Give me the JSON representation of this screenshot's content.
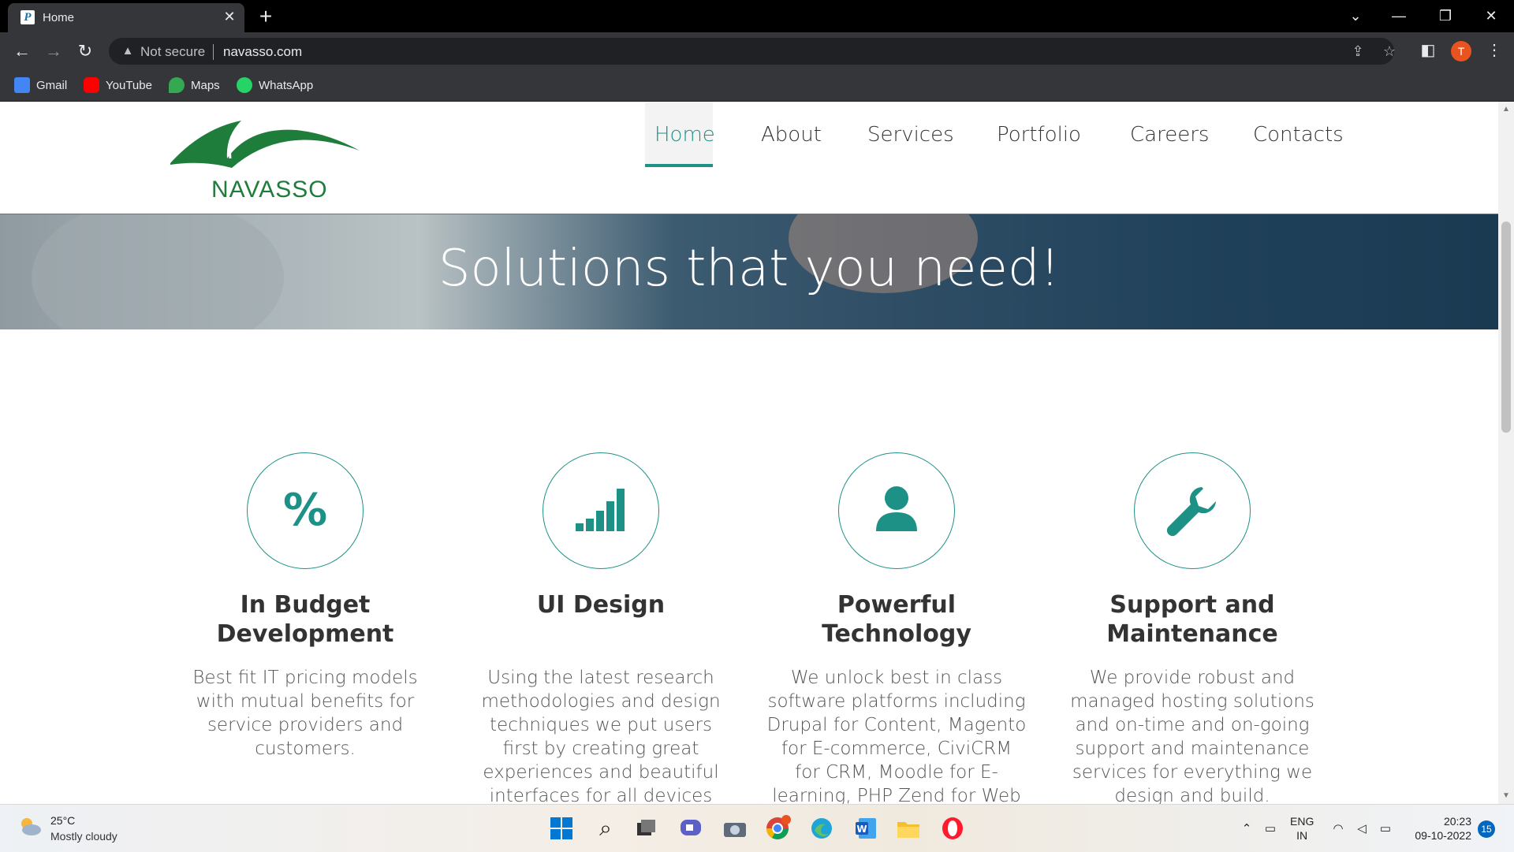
{
  "browser": {
    "tab_title": "Home",
    "tab_close": "✕",
    "new_tab": "+",
    "security": "Not secure",
    "url": "navasso.com",
    "profile_initial": "T",
    "bookmarks": [
      "Gmail",
      "YouTube",
      "Maps",
      "WhatsApp"
    ]
  },
  "site": {
    "logo_text": "NAVASSO",
    "nav": [
      "Home",
      "About",
      "Services",
      "Portfolio",
      "Careers",
      "Contacts"
    ],
    "active_nav": "Home",
    "hero_title": "Solutions that you need!",
    "accent_color": "#1e9187",
    "features": [
      {
        "icon": "percent-icon",
        "title": "In Budget Development",
        "desc": "Best fit IT pricing models with mutual benefits for service providers and customers."
      },
      {
        "icon": "signal-bars-icon",
        "title": "UI Design",
        "desc": "Using the latest research methodologies and design techniques we put users first by creating great experiences and beautiful interfaces for all devices"
      },
      {
        "icon": "user-icon",
        "title": "Powerful Technology",
        "desc": "We unlock best in class software platforms including Drupal for Content, Magento for E-commerce, CiviCRM for CRM, Moodle for E-learning, PHP Zend for Web Applications and iOS"
      },
      {
        "icon": "wrench-icon",
        "title": "Support and Maintenance",
        "desc": "We provide robust and managed hosting solutions and on-time and on-going support and maintenance services for everything we design and build."
      }
    ]
  },
  "taskbar": {
    "temperature": "25°C",
    "weather": "Mostly cloudy",
    "lang_1": "ENG",
    "lang_2": "IN",
    "time": "20:23",
    "date": "09-10-2022",
    "notifications": "15",
    "chrome_badge": "T"
  }
}
